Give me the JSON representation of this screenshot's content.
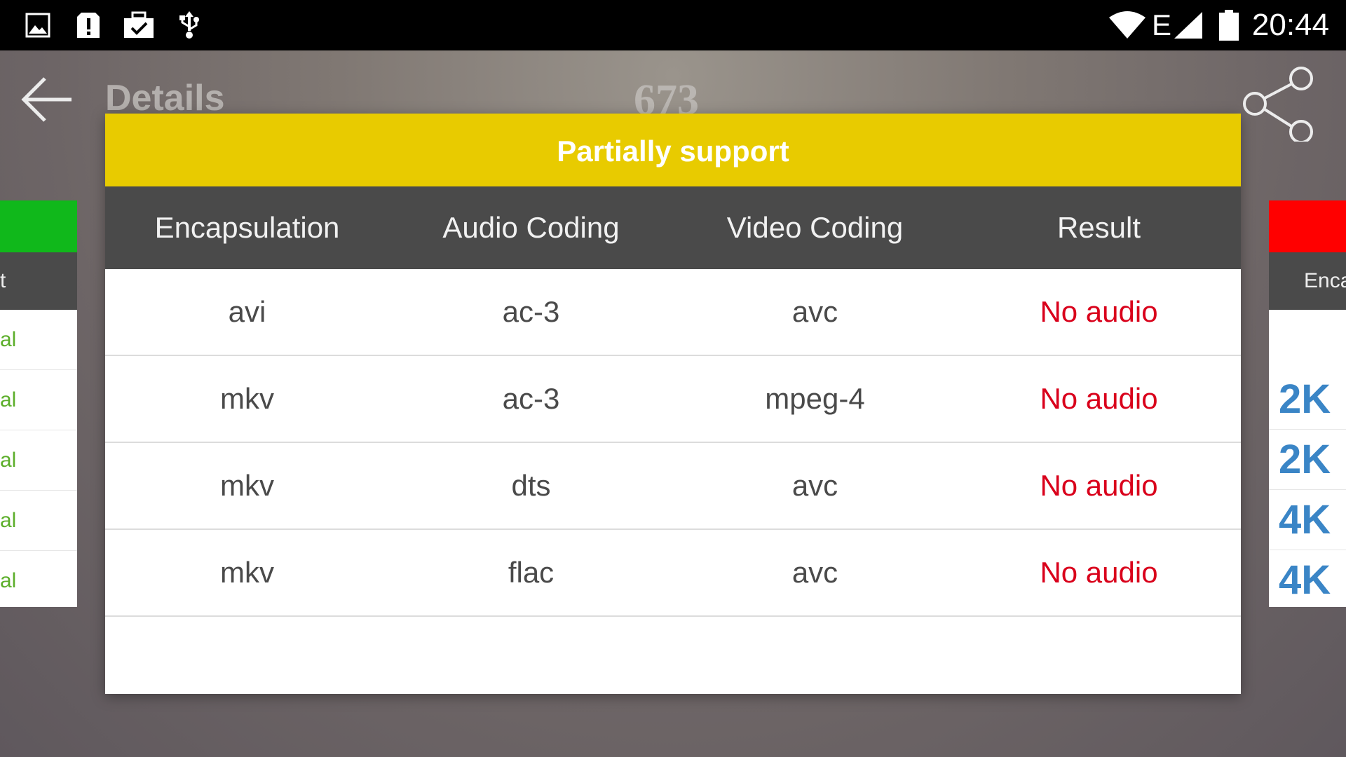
{
  "status_bar": {
    "left_icons": [
      "image-icon",
      "alert-icon",
      "briefcase-check-icon",
      "usb-icon"
    ],
    "right_icons": [
      "wifi-icon",
      "network-e-icon",
      "battery-icon"
    ],
    "network_label": "E",
    "time": "20:44"
  },
  "app_bar": {
    "title": "Details",
    "count": "673"
  },
  "left_card": {
    "header": "t",
    "rows": [
      "al",
      "al",
      "al",
      "al",
      "al"
    ]
  },
  "right_card": {
    "header": "Enca",
    "rows": [
      "2K",
      "2K",
      "4K",
      "4K"
    ]
  },
  "dialog": {
    "title": "Partially support",
    "columns": [
      "Encapsulation",
      "Audio Coding",
      "Video Coding",
      "Result"
    ],
    "rows": [
      {
        "encapsulation": "avi",
        "audio": "ac-3",
        "video": "avc",
        "result": "No audio"
      },
      {
        "encapsulation": "mkv",
        "audio": "ac-3",
        "video": "mpeg-4",
        "result": "No audio"
      },
      {
        "encapsulation": "mkv",
        "audio": "dts",
        "video": "avc",
        "result": "No audio"
      },
      {
        "encapsulation": "mkv",
        "audio": "flac",
        "video": "avc",
        "result": "No audio"
      }
    ]
  },
  "colors": {
    "dialog_title_bg": "#e8cb00",
    "header_bg": "#4a4a4a",
    "result_text": "#d9001b",
    "left_band": "#10b81b",
    "right_band": "#ff0000",
    "resolution_text": "#3a85c6"
  }
}
